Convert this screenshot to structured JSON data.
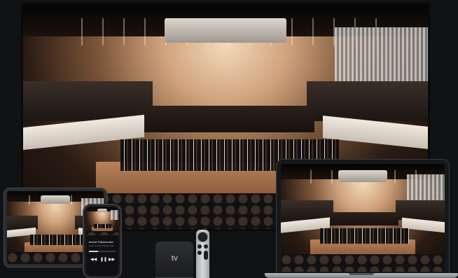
{
  "devices": {
    "tv": {
      "scene": "concert-hall-orchestra"
    },
    "ipad": {
      "scene": "concert-hall-orchestra"
    },
    "iphone": {
      "scene": "concert-hall-orchestra",
      "now_playing_title": "Berliner Philharmoniker",
      "now_playing_subtitle": "Live from the Philharmonie",
      "controls": [
        "backward-icon",
        "pause-icon",
        "forward-icon"
      ]
    },
    "apple_tv": {
      "brand_glyph": "",
      "label": "tv"
    },
    "macbook": {
      "scene": "concert-hall-orchestra"
    }
  },
  "colors": {
    "background": "#111214",
    "stage_wood": "#b8825a",
    "hall_light": "#f3d9b8"
  }
}
